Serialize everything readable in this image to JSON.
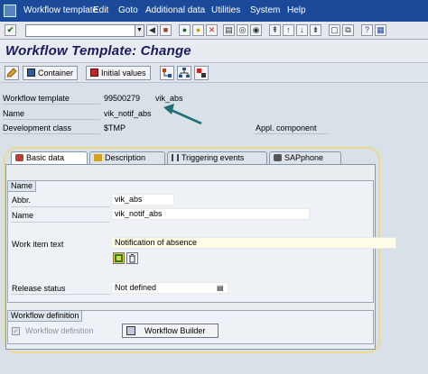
{
  "menu": {
    "items": [
      "Workflow template",
      "Edit",
      "Goto",
      "Additional data",
      "Utilities",
      "System",
      "Help"
    ]
  },
  "screen": {
    "title": "Workflow Template: Change"
  },
  "app_toolbar": {
    "container_label": "Container",
    "initial_values_label": "Initial values"
  },
  "header": {
    "workflow_template_label": "Workflow template",
    "workflow_template_id": "99500279",
    "workflow_template_abbr": "vik_abs",
    "name_label": "Name",
    "name_value": "vik_notif_abs",
    "dev_class_label": "Development class",
    "dev_class_value": "$TMP",
    "appl_component_label": "Appl. component"
  },
  "tabs": [
    {
      "label": "Basic data"
    },
    {
      "label": "Description"
    },
    {
      "label": "Triggering events"
    },
    {
      "label": "SAPphone"
    }
  ],
  "name_group": {
    "title": "Name",
    "abbr_label": "Abbr.",
    "abbr_value": "vik_abs",
    "name_label": "Name",
    "name_value": "vik_notif_abs",
    "work_item_text_label": "Work item text",
    "work_item_text_value": "Notification of absence",
    "release_status_label": "Release status",
    "release_status_value": "Not defined"
  },
  "wf_definition_group": {
    "title": "Workflow definition",
    "checkbox_label": "Workflow definition",
    "checkbox_checked": true,
    "builder_button_label": "Workflow Builder"
  },
  "colors": {
    "menubar": "#1c4a9a",
    "title_text": "#1a1a5e",
    "highlight_border": "#ecd98a",
    "arrow": "#1e6e72"
  }
}
